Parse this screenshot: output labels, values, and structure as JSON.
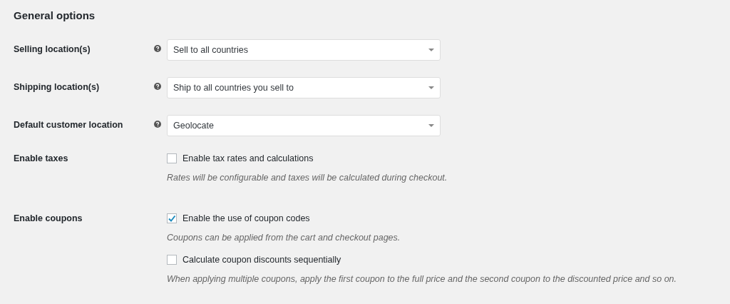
{
  "heading": "General options",
  "rows": [
    {
      "kind": "select",
      "label": "Selling location(s)",
      "help": true,
      "value": "Sell to all countries"
    },
    {
      "kind": "select",
      "label": "Shipping location(s)",
      "help": true,
      "value": "Ship to all countries you sell to"
    },
    {
      "kind": "select",
      "label": "Default customer location",
      "help": true,
      "value": "Geolocate"
    },
    {
      "kind": "checkboxes",
      "label": "Enable taxes",
      "options": [
        {
          "label": "Enable tax rates and calculations",
          "checked": false,
          "description": "Rates will be configurable and taxes will be calculated during checkout."
        }
      ]
    },
    {
      "kind": "checkboxes",
      "label": "Enable coupons",
      "options": [
        {
          "label": "Enable the use of coupon codes",
          "checked": true,
          "description": "Coupons can be applied from the cart and checkout pages."
        },
        {
          "label": "Calculate coupon discounts sequentially",
          "checked": false,
          "description": "When applying multiple coupons, apply the first coupon to the full price and the second coupon to the discounted price and so on."
        }
      ]
    }
  ]
}
